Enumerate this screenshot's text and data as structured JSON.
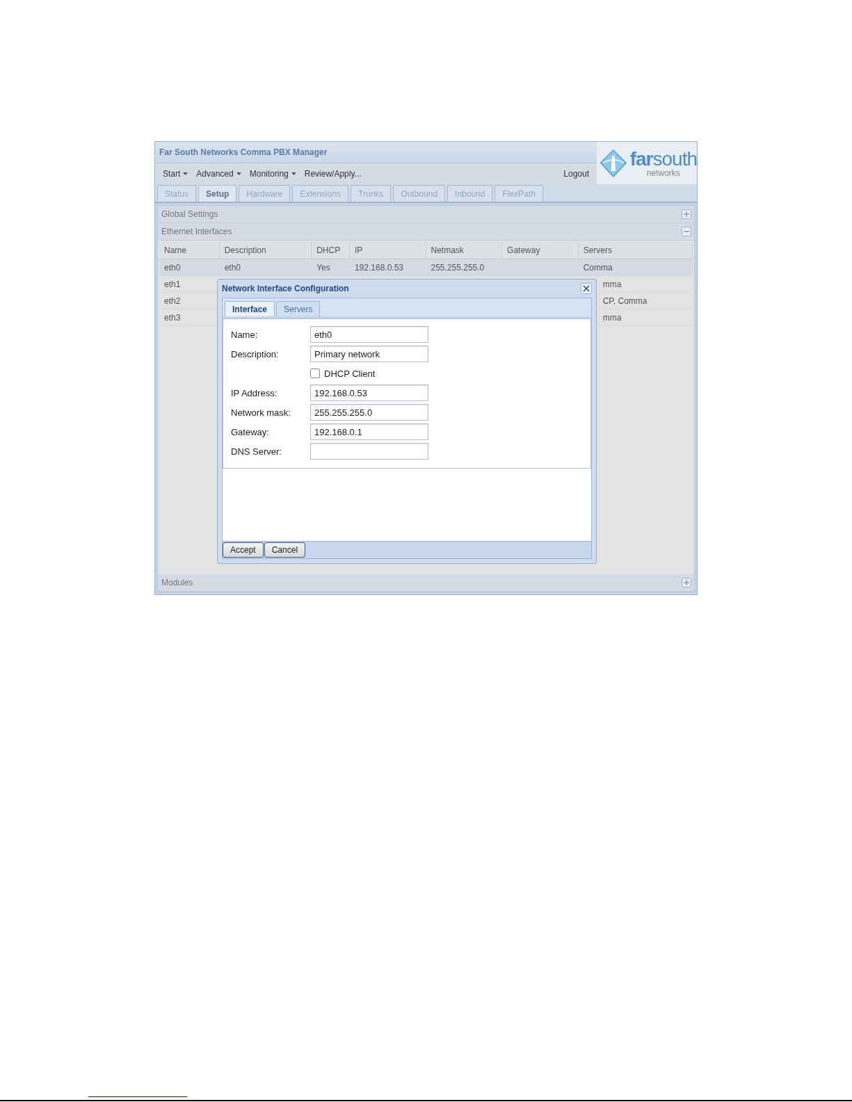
{
  "window": {
    "title": "Far South Networks Comma PBX Manager"
  },
  "logo": {
    "text": "**far**south",
    "subtitle": "networks"
  },
  "menu": [
    {
      "label": "Start",
      "dropdown": true
    },
    {
      "label": "Advanced",
      "dropdown": true
    },
    {
      "label": "Monitoring",
      "dropdown": true
    },
    {
      "label": "Review/Apply...",
      "dropdown": false
    }
  ],
  "logout": "Logout",
  "tabs": [
    {
      "label": "Status",
      "selected": false
    },
    {
      "label": "Setup",
      "selected": true
    },
    {
      "label": "Hardware",
      "selected": false
    },
    {
      "label": "Extensions",
      "selected": false
    },
    {
      "label": "Trunks",
      "selected": false
    },
    {
      "label": "Outbound",
      "selected": false
    },
    {
      "label": "Inbound",
      "selected": false
    },
    {
      "label": "FlexPath",
      "selected": false
    }
  ],
  "panels": [
    {
      "title": "Global Settings",
      "expanded": false
    },
    {
      "title": "Ethernet Interfaces",
      "expanded": true
    },
    {
      "title": "Modules",
      "expanded": false
    }
  ],
  "table": {
    "columns": [
      "Name",
      "Description",
      "DHCP",
      "IP",
      "Netmask",
      "Gateway",
      "Servers"
    ],
    "rows": [
      {
        "name": "eth0",
        "description": "eth0",
        "dhcp": "Yes",
        "ip": "192.168.0.53",
        "netmask": "255.255.255.0",
        "servers": "Comma",
        "covered": false,
        "selected": true
      },
      {
        "name": "eth1",
        "servers": "mma",
        "covered": true,
        "selected": false
      },
      {
        "name": "eth2",
        "servers": "CP, Comma",
        "covered": true,
        "selected": false
      },
      {
        "name": "eth3",
        "servers": "mma",
        "covered": true,
        "selected": false
      }
    ]
  },
  "dialog": {
    "title": "Network Interface Configuration",
    "tabs": [
      {
        "label": "Interface",
        "selected": true
      },
      {
        "label": "Servers",
        "selected": false
      }
    ],
    "fields": [
      {
        "kind": "text",
        "label": "Name:",
        "value": "eth0"
      },
      {
        "kind": "text",
        "label": "Description:",
        "value": "Primary network"
      },
      {
        "kind": "checkbox",
        "label": "DHCP Client",
        "checked": false
      },
      {
        "kind": "text",
        "label": "IP Address:",
        "value": "192.168.0.53"
      },
      {
        "kind": "text",
        "label": "Network mask:",
        "value": "255.255.255.0"
      },
      {
        "kind": "text",
        "label": "Gateway:",
        "value": "192.168.0.1"
      },
      {
        "kind": "text",
        "label": "DNS Server:"
      }
    ],
    "buttons": [
      "Accept",
      "Cancel"
    ]
  }
}
